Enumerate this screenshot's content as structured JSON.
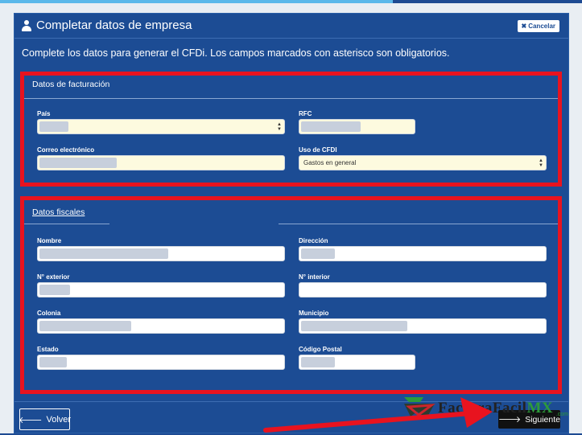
{
  "modal": {
    "title": "Completar datos de empresa",
    "cancel_label": "Cancelar",
    "subtitle": "Complete los datos para generar el CFDi. Los campos marcados con asterisco son obligatorios."
  },
  "billing": {
    "title": "Datos de facturación",
    "pais_label": "País",
    "rfc_label": "RFC",
    "email_label": "Correo electrónico",
    "uso_label": "Uso de CFDI",
    "uso_value": "Gastos en general"
  },
  "fiscal": {
    "title": "Datos fiscales",
    "nombre_label": "Nombre",
    "direccion_label": "Dirección",
    "exterior_label": "N° exterior",
    "interior_label": "N° interior",
    "colonia_label": "Colonia",
    "municipio_label": "Municipio",
    "estado_label": "Estado",
    "cp_label": "Código Postal"
  },
  "footer": {
    "back_label": "Volver",
    "next_label": "Siguiente"
  },
  "watermark": {
    "brand_main": "FacturaFacil",
    "brand_mx": "MX",
    "brand_com": ".com"
  },
  "colors": {
    "modal_bg": "#1c4c94",
    "highlight_red": "#e8131f",
    "field_yellow": "#fdfadf"
  }
}
